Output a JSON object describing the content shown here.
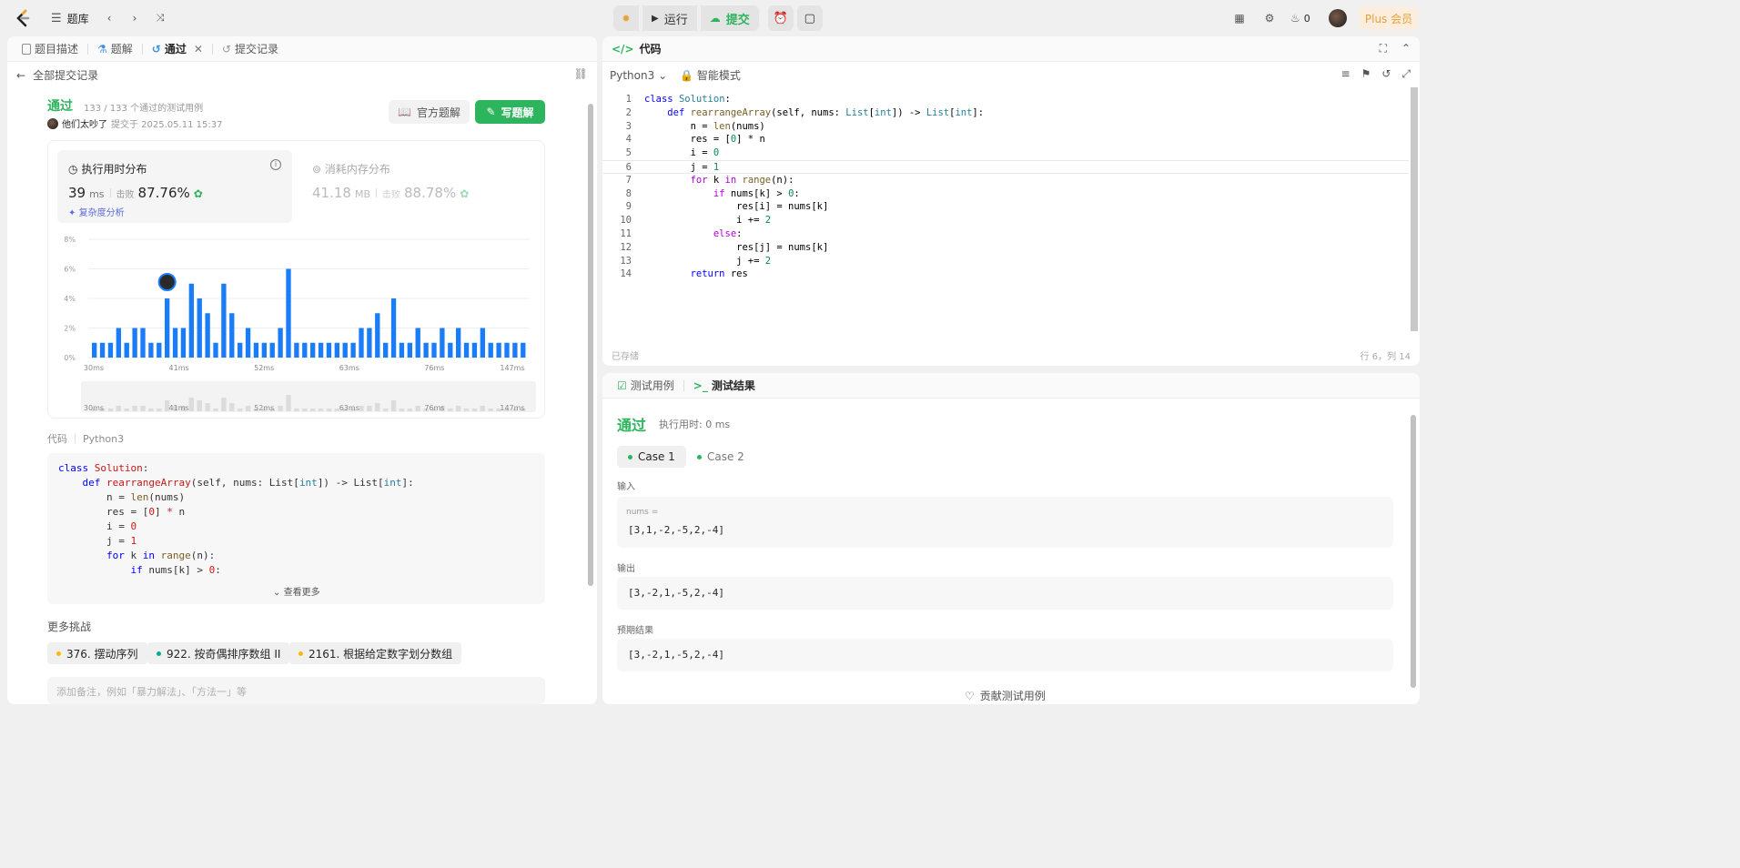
{
  "topbar": {
    "problem_bank": "题库",
    "run": "运行",
    "submit": "提交",
    "fire_count": "0",
    "plus": "Plus 会员"
  },
  "left": {
    "tabs": [
      {
        "label": "题目描述"
      },
      {
        "label": "题解"
      },
      {
        "label": "通过"
      },
      {
        "label": "提交记录"
      }
    ],
    "back": "全部提交记录",
    "status": "通过",
    "testcases": "133 / 133 个通过的测试用例",
    "user": "他们太吵了",
    "submitted_at": "提交于 2025.05.11 15:37",
    "official_solution": "官方题解",
    "write_solution": "写题解",
    "runtime": {
      "label": "执行用时分布",
      "value": "39",
      "unit": "ms",
      "beat_label": "击败",
      "beat": "87.76%",
      "complexity": "复杂度分析"
    },
    "memory": {
      "label": "消耗内存分布",
      "value": "41.18",
      "unit": "MB",
      "beat_label": "击败",
      "beat": "88.78%"
    },
    "code_label": "代码",
    "code_lang": "Python3",
    "more_link": "查看更多",
    "more_challenges": "更多挑战",
    "challenges": [
      {
        "label": "376. 摆动序列",
        "color": "#ffb800"
      },
      {
        "label": "922. 按奇偶排序数组 II",
        "color": "#00af9b"
      },
      {
        "label": "2161. 根据给定数字划分数组",
        "color": "#ffb800"
      }
    ],
    "note_placeholder": "添加备注，例如「暴力解法」、「方法一」等"
  },
  "chart_data": {
    "type": "bar",
    "yticks": [
      "8%",
      "6%",
      "4%",
      "2%",
      "0%"
    ],
    "ylim": [
      0,
      8
    ],
    "xticks": [
      "30ms",
      "41ms",
      "52ms",
      "63ms",
      "76ms",
      "147ms"
    ],
    "values": [
      1,
      1,
      1,
      2,
      1,
      2,
      2,
      1,
      1,
      4,
      2,
      2,
      5,
      4,
      3,
      1,
      5,
      3,
      1,
      2,
      1,
      1,
      1,
      2,
      6,
      1,
      1,
      1,
      1,
      1,
      1,
      1,
      1,
      2,
      2,
      3,
      1,
      4,
      1,
      1,
      2,
      1,
      1,
      2,
      1,
      2,
      1,
      1,
      2,
      1,
      1,
      1,
      1,
      1
    ],
    "highlight_index": 9,
    "bar_color": "#1a7cf7",
    "minimap_xticks": [
      "30ms",
      "41ms",
      "52ms",
      "63ms",
      "76ms",
      "147ms"
    ]
  },
  "code": {
    "title": "代码",
    "lang": "Python3",
    "mode": "智能模式",
    "saved": "已存储",
    "cursor": "行 6，列 14"
  },
  "result": {
    "tab_testcase": "测试用例",
    "tab_result": "测试结果",
    "status": "通过",
    "runtime": "执行用时: 0 ms",
    "case1": "Case 1",
    "case2": "Case 2",
    "input_label": "输入",
    "input_key": "nums =",
    "input_value": "[3,1,-2,-5,2,-4]",
    "output_label": "输出",
    "output_value": "[3,-2,1,-5,2,-4]",
    "expected_label": "预期结果",
    "expected_value": "[3,-2,1,-5,2,-4]",
    "contribute": "贡献测试用例"
  },
  "editor_lines": [
    "class Solution:",
    "    def rearrangeArray(self, nums: List[int]) -> List[int]:",
    "        n = len(nums)",
    "        res = [0] * n",
    "        i = 0",
    "        j = 1",
    "        for k in range(n):",
    "            if nums[k] > 0:",
    "                res[i] = nums[k]",
    "                i += 2",
    "            else:",
    "                res[j] = nums[k]",
    "                j += 2",
    "        return res"
  ]
}
